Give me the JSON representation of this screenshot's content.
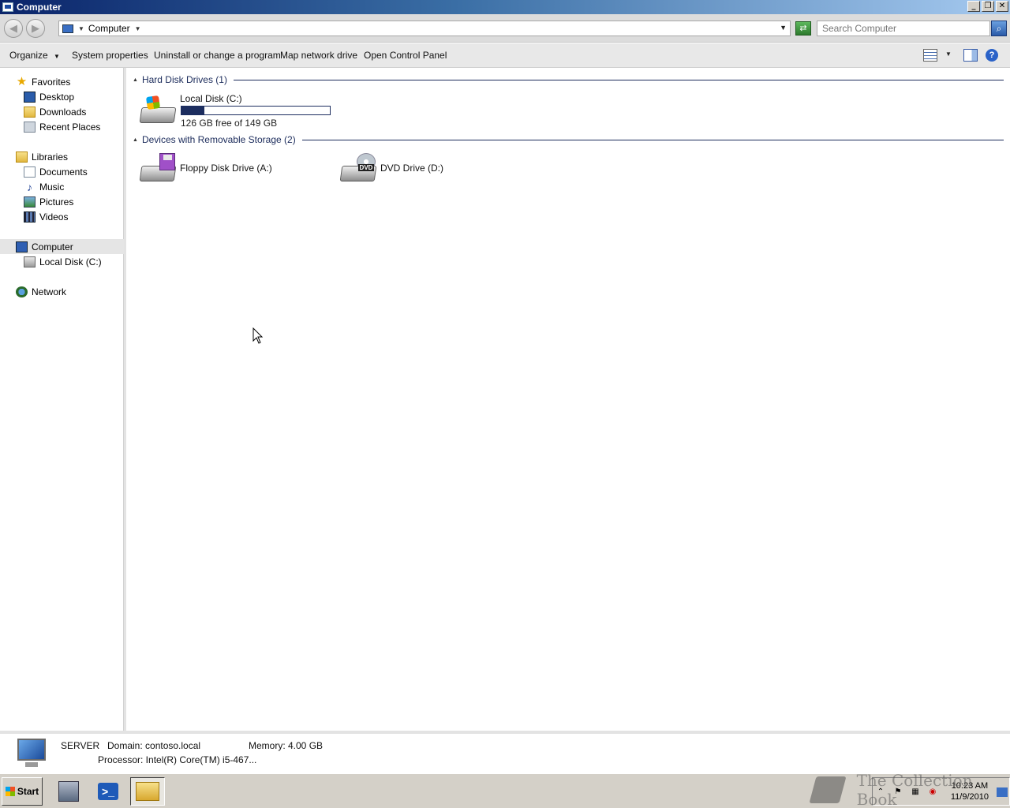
{
  "window": {
    "title": "Computer",
    "controls": {
      "minimize": "_",
      "maximize": "❐",
      "close": "✕"
    }
  },
  "address_bar": {
    "path": "Computer",
    "search_placeholder": "Search Computer"
  },
  "toolbar": {
    "organize": "Organize",
    "system_properties": "System properties",
    "uninstall": "Uninstall or change a program",
    "map_drive": "Map network drive",
    "control_panel": "Open Control Panel"
  },
  "nav": {
    "favorites": "Favorites",
    "desktop": "Desktop",
    "downloads": "Downloads",
    "recent": "Recent Places",
    "libraries": "Libraries",
    "documents": "Documents",
    "music": "Music",
    "pictures": "Pictures",
    "videos": "Videos",
    "computer": "Computer",
    "local_disk": "Local Disk (C:)",
    "network": "Network"
  },
  "groups": {
    "hdd": "Hard Disk Drives (1)",
    "removable": "Devices with Removable Storage (2)"
  },
  "drives": {
    "c": {
      "name": "Local Disk (C:)",
      "free": "126 GB free of 149 GB",
      "used_fraction": 0.154
    },
    "a": {
      "name": "Floppy Disk Drive (A:)"
    },
    "d": {
      "name": "DVD Drive (D:)",
      "badge": "DVD"
    }
  },
  "details": {
    "name": "SERVER",
    "domain": "Domain: contoso.local",
    "memory": "Memory: 4.00 GB",
    "processor": "Processor: Intel(R) Core(TM) i5-467..."
  },
  "taskbar": {
    "start": "Start",
    "time": "10:23 AM",
    "date": "11/9/2010",
    "ps_glyph": ">_"
  },
  "watermark": "The Collection Book"
}
